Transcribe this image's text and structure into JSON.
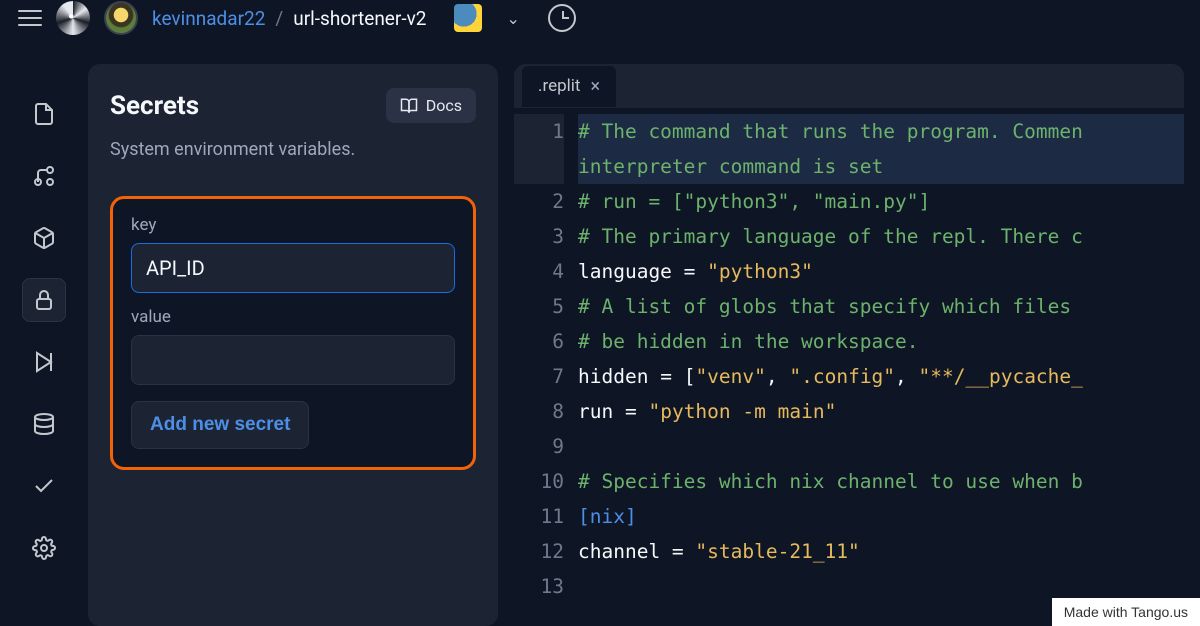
{
  "header": {
    "username": "kevinnadar22",
    "separator": "/",
    "repo": "url-shortener-v2"
  },
  "secrets": {
    "title": "Secrets",
    "docs_label": "Docs",
    "subtitle": "System environment variables.",
    "key_label": "key",
    "key_value": "API_ID",
    "value_label": "value",
    "value_value": "",
    "add_button": "Add new secret"
  },
  "editor": {
    "tab_name": ".replit",
    "lines": [
      {
        "num": 1,
        "segments": [
          {
            "cls": "tok-comment",
            "t": "# The command that runs the program. Commen"
          }
        ],
        "hl": true
      },
      {
        "num": "",
        "segments": [
          {
            "cls": "tok-comment",
            "t": "interpreter command is set"
          }
        ],
        "hl": true
      },
      {
        "num": 2,
        "segments": [
          {
            "cls": "tok-comment",
            "t": "# run = [\"python3\", \"main.py\"]"
          }
        ]
      },
      {
        "num": 3,
        "segments": [
          {
            "cls": "tok-comment",
            "t": "# The primary language of the repl. There c"
          }
        ]
      },
      {
        "num": 4,
        "segments": [
          {
            "cls": "tok-key",
            "t": "language"
          },
          {
            "cls": "tok-op",
            "t": " = "
          },
          {
            "cls": "tok-str",
            "t": "\"python3\""
          }
        ]
      },
      {
        "num": 5,
        "segments": [
          {
            "cls": "tok-comment",
            "t": "# A list of globs that specify which files "
          }
        ]
      },
      {
        "num": 6,
        "segments": [
          {
            "cls": "tok-comment",
            "t": "# be hidden in the workspace."
          }
        ]
      },
      {
        "num": 7,
        "segments": [
          {
            "cls": "tok-key",
            "t": "hidden"
          },
          {
            "cls": "tok-op",
            "t": " = "
          },
          {
            "cls": "tok-br",
            "t": "["
          },
          {
            "cls": "tok-str",
            "t": "\"venv\""
          },
          {
            "cls": "tok-op",
            "t": ", "
          },
          {
            "cls": "tok-str",
            "t": "\".config\""
          },
          {
            "cls": "tok-op",
            "t": ", "
          },
          {
            "cls": "tok-str",
            "t": "\"**/__pycache_"
          }
        ]
      },
      {
        "num": 8,
        "segments": [
          {
            "cls": "tok-key",
            "t": "run"
          },
          {
            "cls": "tok-op",
            "t": " = "
          },
          {
            "cls": "tok-str",
            "t": "\"python -m main\""
          }
        ]
      },
      {
        "num": 9,
        "segments": []
      },
      {
        "num": 10,
        "segments": [
          {
            "cls": "tok-comment",
            "t": "# Specifies which nix channel to use when b"
          }
        ]
      },
      {
        "num": 11,
        "segments": [
          {
            "cls": "tok-section",
            "t": "[nix]"
          }
        ]
      },
      {
        "num": 12,
        "segments": [
          {
            "cls": "tok-key",
            "t": "channel"
          },
          {
            "cls": "tok-op",
            "t": " = "
          },
          {
            "cls": "tok-str",
            "t": "\"stable-21_11\""
          }
        ]
      },
      {
        "num": 13,
        "segments": []
      }
    ]
  },
  "watermark": "Made with Tango.us"
}
